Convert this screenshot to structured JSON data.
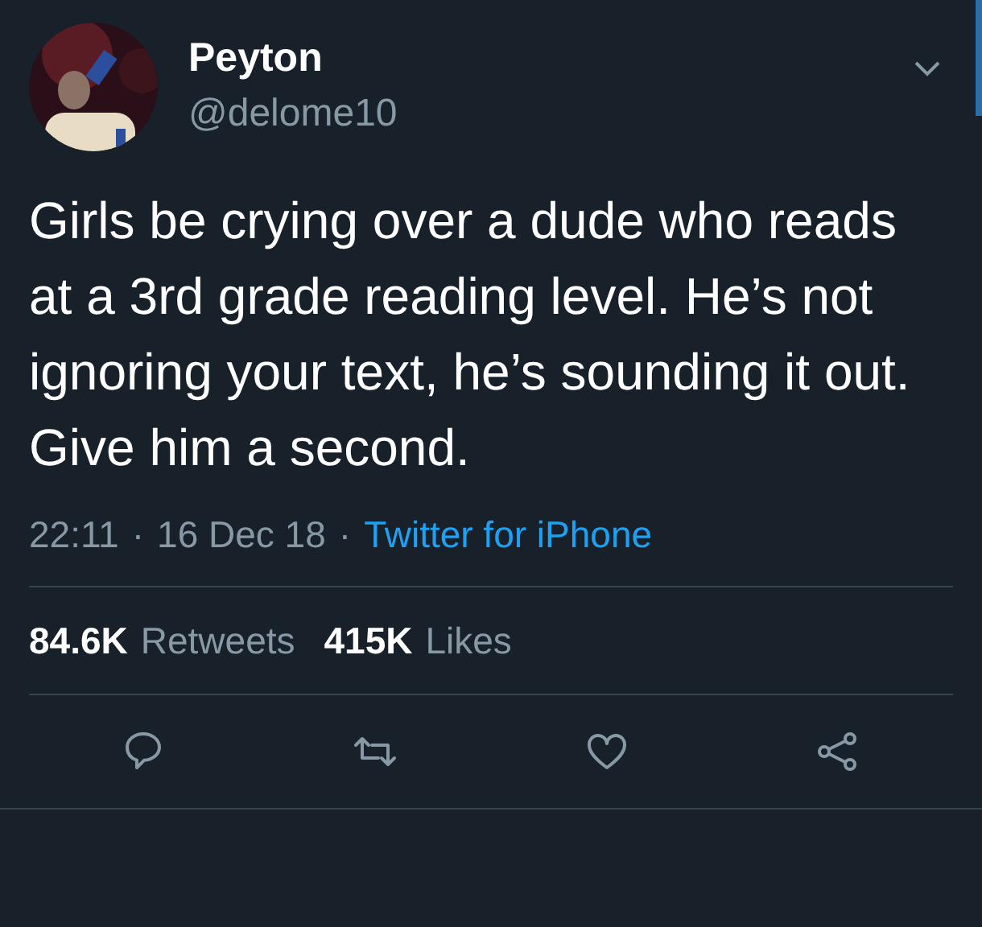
{
  "author": {
    "name": "Peyton",
    "handle": "@delome10"
  },
  "text": "Girls be crying over a dude who reads at a 3rd grade reading level. He’s not ignoring your text, he’s sounding it out. Give him a second.",
  "meta": {
    "time": "22:11",
    "separator_1": "·",
    "date": "16 Dec 18",
    "separator_2": "·",
    "source": "Twitter for iPhone"
  },
  "stats": [
    {
      "count": "84.6K",
      "label": "Retweets"
    },
    {
      "count": "415K",
      "label": "Likes"
    }
  ],
  "actions": [
    {
      "kind": "reply"
    },
    {
      "kind": "retweet"
    },
    {
      "kind": "like"
    },
    {
      "kind": "share"
    }
  ]
}
